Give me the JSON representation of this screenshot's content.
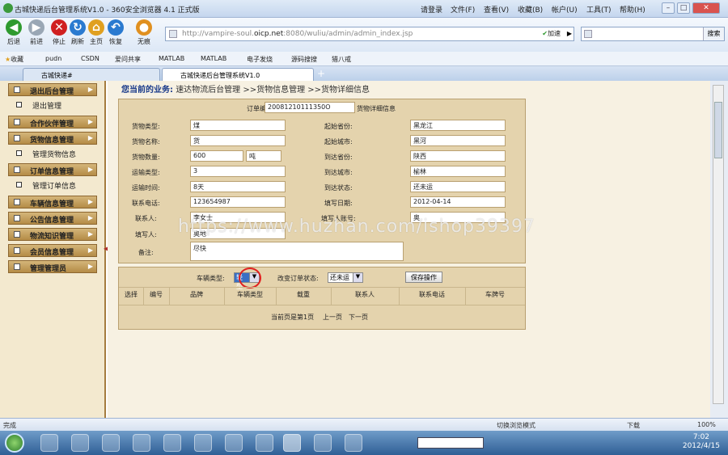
{
  "window": {
    "title": "古城快递后台管理系统V1.0 - 360安全浏览器 4.1 正式版"
  },
  "menu": [
    "请登录",
    "文件(F)",
    "查看(V)",
    "收藏(B)",
    "帐户(U)",
    "工具(T)",
    "帮助(H)"
  ],
  "toolbar": {
    "buttons": [
      {
        "label": "后退",
        "icon": "back-arrow-icon",
        "color": "#2f9a2f"
      },
      {
        "label": "前进",
        "icon": "forward-arrow-icon",
        "color": "#9aa7b5"
      },
      {
        "label": "停止",
        "icon": "stop-x-icon",
        "color": "#d02020"
      },
      {
        "label": "刷新",
        "icon": "refresh-icon",
        "color": "#2a7ad0"
      },
      {
        "label": "主页",
        "icon": "home-icon",
        "color": "#e0a020"
      },
      {
        "label": "恢复",
        "icon": "undo-icon",
        "color": "#2a7ad0"
      },
      {
        "label": "无痕",
        "icon": "incognito-icon",
        "color": "#e09020"
      }
    ],
    "address_prefix": "http://vampire-soul.",
    "address_domain": "oicp.net",
    "address_suffix": ":8080/wuliu/admin/admin_index.jsp",
    "accelerate": "加速",
    "search_button": "搜索"
  },
  "favorites": [
    "收藏",
    "pudn",
    "CSDN",
    "爱问共享",
    "MATLAB",
    "MATLAB",
    "电子发烧",
    "源码搜搜",
    "猎八戒"
  ],
  "tab": {
    "label": "古城快递#",
    "active_label": "古城快递后台管理系统V1.0"
  },
  "sidebar": {
    "items": [
      {
        "label": "退出后台管理",
        "sub": "退出管理"
      },
      {
        "label": "合作伙伴管理"
      },
      {
        "label": "货物信息管理",
        "sub": "管理货物信息"
      },
      {
        "label": "订单信息管理",
        "sub": "管理订单信息"
      },
      {
        "label": "车辆信息管理"
      },
      {
        "label": "公告信息管理"
      },
      {
        "label": "物流知识管理"
      },
      {
        "label": "会员信息管理"
      },
      {
        "label": "管理管理员"
      }
    ]
  },
  "breadcrumb": {
    "prefix": "您当前的业务:",
    "path": "速达物流后台管理 >>货物信息管理 >>货物详细信息"
  },
  "order": {
    "number_label": "订单编号:",
    "number_value": "20081210111350O",
    "info_caption": "货物详细信息",
    "cargo_type_label": "货物类型:",
    "cargo_type": "煤",
    "origin_province_label": "起始省份:",
    "origin_province": "黑龙江",
    "cargo_name_label": "货物名称:",
    "cargo_name": "货",
    "origin_city_label": "起始城市:",
    "origin_city": "黑河",
    "quantity_label": "货物数量:",
    "quantity": "600",
    "quantity_unit": "吨",
    "dest_province_label": "到达省份:",
    "dest_province": "陕西",
    "transport_type_label": "运输类型:",
    "transport_type": "3",
    "dest_city_label": "到达城市:",
    "dest_city": "榆林",
    "transport_time_label": "运输时间:",
    "transport_time": "8天",
    "arrival_status_label": "到达状态:",
    "arrival_status": "还未运",
    "phone_label": "联系电话:",
    "phone": "123654987",
    "fill_date_label": "填写日期:",
    "fill_date": "2012-04-14",
    "contact_label": "联系人:",
    "contact": "李女士",
    "filler_account_label": "填写人账号:",
    "filler_account": "奥",
    "filler_label": "填写人:",
    "filler": "奥地",
    "remark_label": "备注:",
    "remark": "尽快"
  },
  "vehicle": {
    "type_label": "车辆类型:",
    "type_value": "轻型",
    "status_label": "改变订单状态:",
    "status_value": "还未运",
    "save_button": "保存操作",
    "columns": [
      "选择",
      "编号",
      "品牌",
      "车辆类型",
      "载重",
      "联系人",
      "联系电话",
      "车牌号"
    ],
    "pager": {
      "current": "当前页是第1页",
      "prev": "上一页",
      "next": "下一页"
    }
  },
  "watermark": "https://www.huzhan.com/ishop39397",
  "statusbar": {
    "left": "完成",
    "mode": "切换浏览模式",
    "download": "下载",
    "zoom": "100%"
  },
  "taskbar": {
    "time": "7:02",
    "date": "2012/4/15"
  }
}
